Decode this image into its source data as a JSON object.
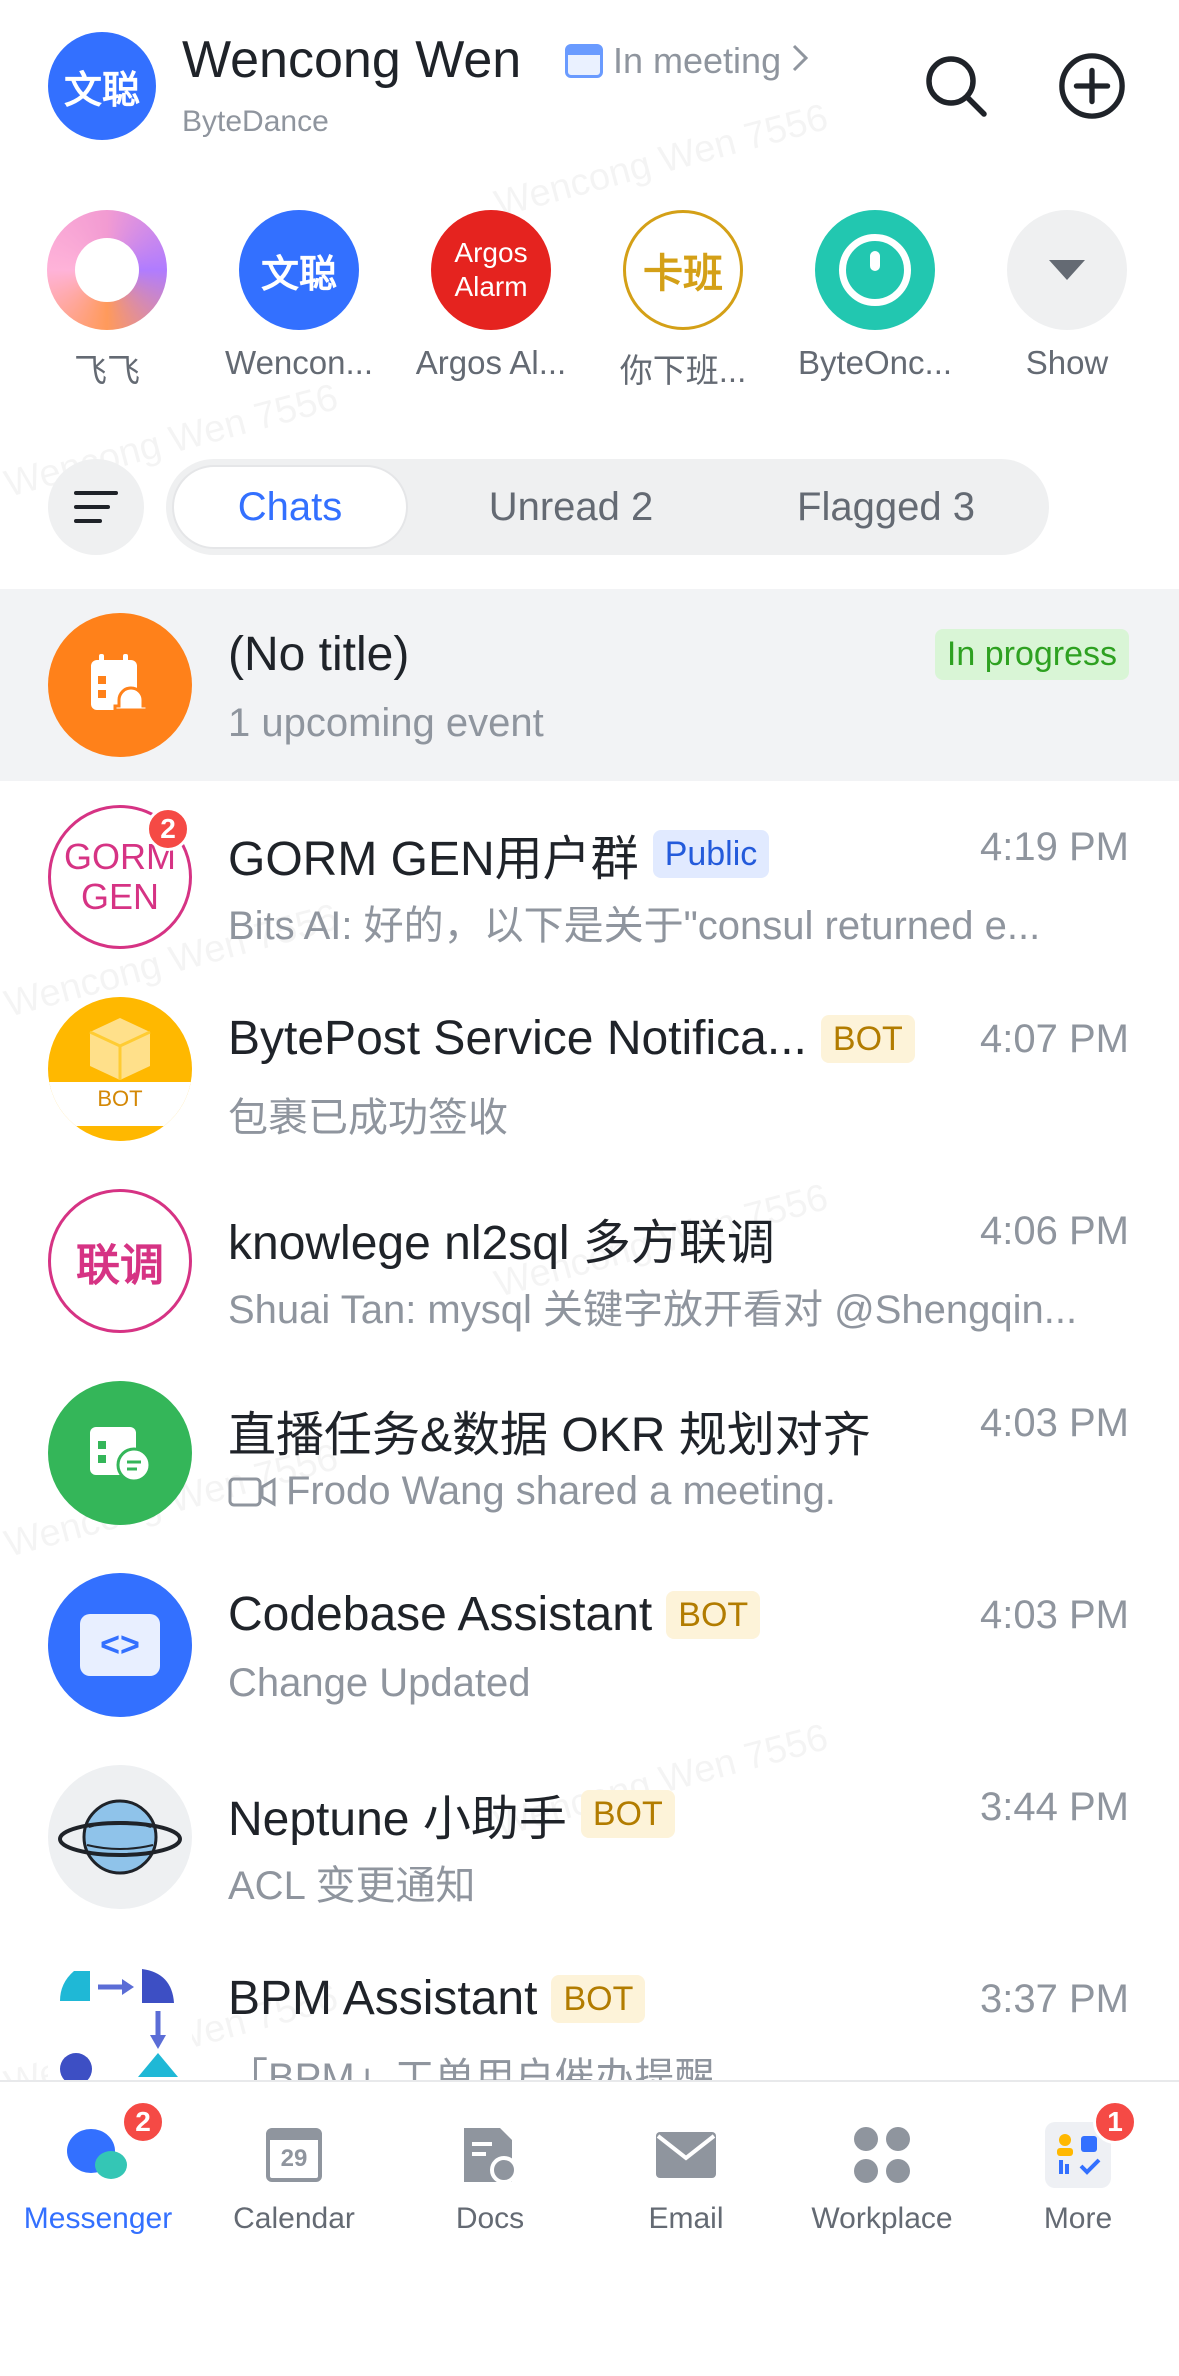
{
  "header": {
    "avatar_text": "文聪",
    "name": "Wencong Wen",
    "status": "In meeting",
    "org": "ByteDance"
  },
  "shortcuts": [
    {
      "label": "飞飞",
      "avatar_text": ""
    },
    {
      "label": "Wencon...",
      "avatar_text": "文聪"
    },
    {
      "label": "Argos Al...",
      "avatar_text": "Argos Alarm"
    },
    {
      "label": "你下班...",
      "avatar_text": "卡班"
    },
    {
      "label": "ByteOnc...",
      "avatar_text": ""
    },
    {
      "label": "Show",
      "avatar_text": ""
    }
  ],
  "filters": {
    "tabs": [
      {
        "label": "Chats",
        "active": true
      },
      {
        "label": "Unread 2",
        "active": false
      },
      {
        "label": "Flagged 3",
        "active": false
      }
    ]
  },
  "chats": [
    {
      "title": "(No title)",
      "subtitle": "1 upcoming event",
      "status": "In progress",
      "pinned": true
    },
    {
      "title": "GORM GEN用户群",
      "tag": "Public",
      "time": "4:19 PM",
      "subtitle": "Bits AI: 好的，以下是关于\"consul returned e...",
      "badge": "2",
      "avatar_text": "GORM GEN"
    },
    {
      "title": "BytePost Service Notifica...",
      "tag": "BOT",
      "time": "4:07 PM",
      "subtitle": "包裹已成功签收",
      "avatar_text": "BOT"
    },
    {
      "title": "knowlege nl2sql 多方联调",
      "time": "4:06 PM",
      "subtitle": "Shuai Tan: mysql 关键字放开看对 @Shengqin...",
      "avatar_text": "联调"
    },
    {
      "title": "直播任务&数据 OKR 规划对齐",
      "time": "4:03 PM",
      "subtitle": "Frodo Wang shared a meeting."
    },
    {
      "title": "Codebase Assistant",
      "tag": "BOT",
      "time": "4:03 PM",
      "subtitle": "Change Updated",
      "avatar_text": "<>"
    },
    {
      "title": "Neptune 小助手",
      "tag": "BOT",
      "time": "3:44 PM",
      "subtitle": "ACL 变更通知"
    },
    {
      "title": "BPM Assistant",
      "tag": "BOT",
      "time": "3:37 PM",
      "subtitle": "「BPM」工单用户催办提醒"
    }
  ],
  "tabbar": [
    {
      "label": "Messenger",
      "badge": "2",
      "active": true
    },
    {
      "label": "Calendar",
      "icon_text": "29"
    },
    {
      "label": "Docs"
    },
    {
      "label": "Email"
    },
    {
      "label": "Workplace"
    },
    {
      "label": "More",
      "badge": "1"
    }
  ],
  "watermark": "Wencong Wen 7556",
  "colors": {
    "accent": "#3370ff",
    "badge": "#f54a45",
    "bot_tag": "#b27c00",
    "in_progress": "#2ea121"
  }
}
